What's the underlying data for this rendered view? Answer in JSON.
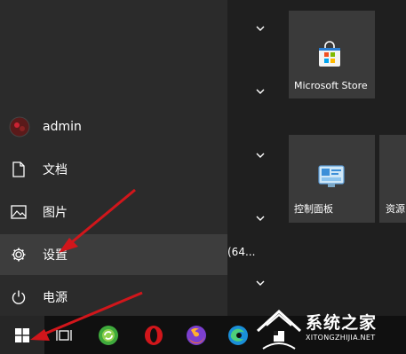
{
  "nav": {
    "user": "admin",
    "documents": "文档",
    "pictures": "图片",
    "settings": "设置",
    "power": "电源"
  },
  "list": {
    "partial_item": "(64..."
  },
  "tiles": {
    "store": "Microsoft Store",
    "control_panel": "控制面板",
    "resources": "资源"
  },
  "watermark": {
    "name": "系统之家",
    "url": "XITONGZHIJIA.NET"
  },
  "colors": {
    "accent_red": "#d1161b",
    "highlight": "#3d3d3d"
  }
}
